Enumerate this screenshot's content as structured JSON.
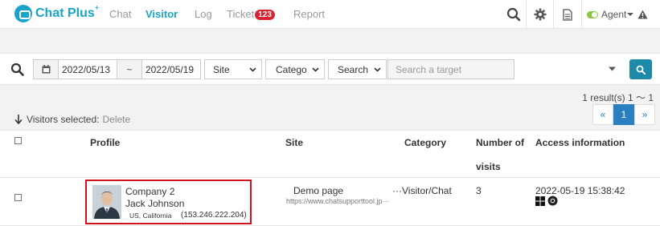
{
  "brand": {
    "name": "Chat Plus",
    "plus": "+"
  },
  "nav": [
    {
      "label": "Chat",
      "active": false
    },
    {
      "label": "Visitor",
      "active": true
    },
    {
      "label": "Log",
      "active": false
    },
    {
      "label": "Ticket",
      "active": false,
      "badge": "123"
    },
    {
      "label": "Report",
      "active": false
    }
  ],
  "agent": {
    "label": "Agent",
    "status_color": "#8cc63f"
  },
  "filters": {
    "date_from": "2022/05/13",
    "date_sep": "~",
    "date_to": "2022/05/19",
    "site": "Site",
    "category": "Catego",
    "search_mode": "Search",
    "search_placeholder": "Search a target"
  },
  "results": {
    "summary": "1 result(s) 1 ～ 1"
  },
  "pagination": {
    "prev": "«",
    "current": "1",
    "next": "»"
  },
  "selection": {
    "label": "Visitors selected:",
    "delete": "Delete"
  },
  "table": {
    "headers": {
      "profile": "Profile",
      "site": "Site",
      "category": "Category",
      "visits_1": "Number of",
      "visits_2": "visits",
      "access": "Access information"
    },
    "rows": [
      {
        "company": "Company 2",
        "name": "Jack Johnson",
        "location": "US, California",
        "ip": "(153.246.222.204)",
        "site_title": "Demo page",
        "site_url": "https://www.chatsupporttool.jp···",
        "category": "···Visitor/Chat",
        "visits": "3",
        "access_time": "2022-05-19 15:38:42"
      }
    ]
  },
  "colors": {
    "accent": "#1aa3c8",
    "badge": "#d9232f",
    "highlight": "#d0101a",
    "button": "#1d8aa8",
    "pager": "#2a7fc0"
  }
}
